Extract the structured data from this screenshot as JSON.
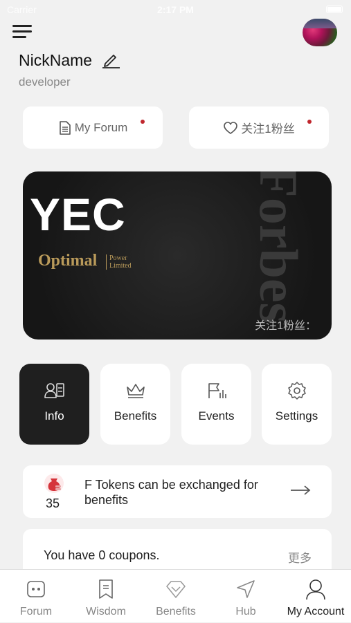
{
  "status_bar": {
    "carrier": "Carrier",
    "time": "2:17 PM"
  },
  "profile": {
    "nickname": "NickName",
    "role": "developer"
  },
  "quick_links": [
    {
      "label": "My Forum",
      "icon": "document-icon",
      "has_badge": true
    },
    {
      "label": "关注1粉丝",
      "icon": "heart-icon",
      "has_badge": true
    }
  ],
  "member_card": {
    "brand": "YEC",
    "subtitle": "Optimal",
    "subtitle_small_1": "Power",
    "subtitle_small_2": "Limited",
    "watermark": "Forbes",
    "followers": "关注1粉丝："
  },
  "tiles": [
    {
      "label": "Info",
      "icon": "id-card-icon",
      "active": true
    },
    {
      "label": "Benefits",
      "icon": "crown-icon",
      "active": false
    },
    {
      "label": "Events",
      "icon": "flag-chart-icon",
      "active": false
    },
    {
      "label": "Settings",
      "icon": "gear-icon",
      "active": false
    }
  ],
  "tokens": {
    "count": "35",
    "text": "F Tokens can be exchanged for benefits",
    "icon": "money-bag-icon"
  },
  "coupons": {
    "text": "You have 0 coupons.",
    "more": "更多"
  },
  "tabbar": [
    {
      "label": "Forum",
      "icon": "robot-icon",
      "active": false
    },
    {
      "label": "Wisdom",
      "icon": "bookmark-icon",
      "active": false
    },
    {
      "label": "Benefits",
      "icon": "diamond-icon",
      "active": false
    },
    {
      "label": "Hub",
      "icon": "navigation-icon",
      "active": false
    },
    {
      "label": "My Account",
      "icon": "person-icon",
      "active": true
    }
  ],
  "colors": {
    "badge": "#c0262d",
    "card_gold": "#b99a5a",
    "active_tile": "#1f1f1f",
    "background": "#f1f1f1"
  }
}
